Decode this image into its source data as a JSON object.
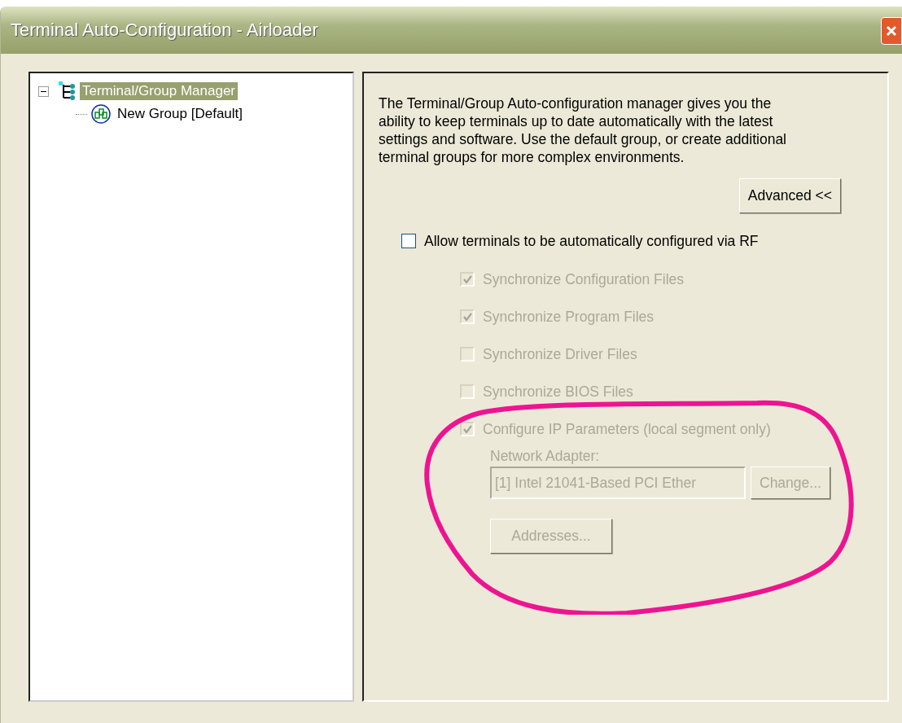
{
  "window": {
    "title": "Terminal Auto-Configuration - Airloader"
  },
  "tree": [
    {
      "label": "Terminal/Group Manager",
      "kind": "manager",
      "selected": true,
      "expanded": true,
      "children": [
        {
          "label": "New Group [Default]",
          "kind": "group",
          "selected": false
        }
      ]
    }
  ],
  "description": "The Terminal/Group Auto-configuration manager gives you the ability to keep terminals up to date automatically with the latest settings and software.  Use the default group, or create additional terminal groups for more complex environments.",
  "advanced_button": {
    "label": "Advanced <<"
  },
  "allow_rf": {
    "label": "Allow terminals to be automatically configured via RF",
    "checked": false,
    "disabled": false
  },
  "sync_options": [
    {
      "label": "Synchronize Configuration Files",
      "checked": true,
      "disabled": true
    },
    {
      "label": "Synchronize Program Files",
      "checked": true,
      "disabled": true
    },
    {
      "label": "Synchronize Driver Files",
      "checked": false,
      "disabled": true
    },
    {
      "label": "Synchronize BIOS Files",
      "checked": false,
      "disabled": true
    },
    {
      "label": "Configure IP Parameters (local segment only)",
      "checked": true,
      "disabled": true
    }
  ],
  "network": {
    "label": "Network Adapter:",
    "value": "[1] Intel 21041-Based PCI Ether",
    "disabled": true,
    "change_button": "Change...",
    "addresses_button": "Addresses..."
  }
}
